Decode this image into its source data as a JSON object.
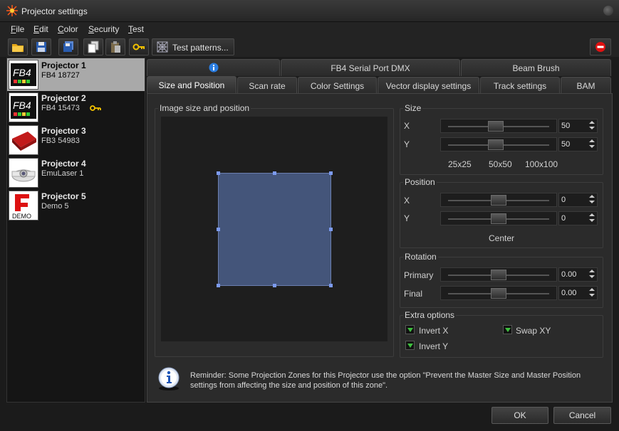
{
  "window": {
    "title": "Projector settings"
  },
  "menu": [
    {
      "label": "File",
      "underline": "F",
      "rest": "ile"
    },
    {
      "label": "Edit",
      "underline": "E",
      "rest": "dit"
    },
    {
      "label": "Color",
      "underline": "C",
      "rest": "olor"
    },
    {
      "label": "Security",
      "underline": "S",
      "rest": "ecurity"
    },
    {
      "label": "Test",
      "underline": "T",
      "rest": "est"
    }
  ],
  "toolbar": {
    "test_patterns_label": "Test patterns...",
    "icons": [
      "open-folder-icon",
      "save-icon",
      "save-as-icon",
      "copy-icon",
      "paste-icon",
      "key-icon",
      "test-pattern-icon",
      "stop-icon"
    ]
  },
  "projectors": [
    {
      "name": "Projector 1",
      "device": "FB4 18727",
      "thumb": "FB4",
      "selected": true
    },
    {
      "name": "Projector 2",
      "device": "FB4 15473",
      "thumb": "FB4",
      "has_key": true
    },
    {
      "name": "Projector 3",
      "device": "FB3 54983",
      "thumb": "FB3"
    },
    {
      "name": "Projector 4",
      "device": "EmuLaser 1",
      "thumb": "projector"
    },
    {
      "name": "Projector 5",
      "device": "Demo 5",
      "thumb": "DEMO"
    }
  ],
  "tabs_top": [
    {
      "label": ""
    },
    {
      "label": "FB4 Serial Port DMX"
    },
    {
      "label": "Beam Brush"
    }
  ],
  "tabs_bottom": [
    {
      "label": "Size and Position",
      "active": true
    },
    {
      "label": "Scan rate"
    },
    {
      "label": "Color Settings"
    },
    {
      "label": "Vector display settings"
    },
    {
      "label": "Track settings"
    },
    {
      "label": "BAM"
    }
  ],
  "image_group": {
    "label": "Image size and position"
  },
  "size": {
    "label": "Size",
    "x_label": "X",
    "x_value": "50",
    "y_label": "Y",
    "y_value": "50",
    "presets": [
      "25x25",
      "50x50",
      "100x100"
    ]
  },
  "position": {
    "label": "Position",
    "x_label": "X",
    "x_value": "0",
    "y_label": "Y",
    "y_value": "0",
    "center_label": "Center"
  },
  "rotation": {
    "label": "Rotation",
    "primary_label": "Primary",
    "primary_value": "0.00",
    "final_label": "Final",
    "final_value": "0.00"
  },
  "extra": {
    "label": "Extra options",
    "invert_x": "Invert X",
    "swap_xy": "Swap XY",
    "invert_y": "Invert Y"
  },
  "reminder": "Reminder: Some Projection Zones for this Projector use the option \"Prevent the Master Size and Master Position settings from affecting the size and position of this zone\".",
  "buttons": {
    "ok": "OK",
    "cancel": "Cancel"
  },
  "colors": {
    "accent_rect": "#44557a",
    "handle": "#7c9af0",
    "check": "#3fbf3f",
    "selected_item": "#a9a9a9"
  }
}
